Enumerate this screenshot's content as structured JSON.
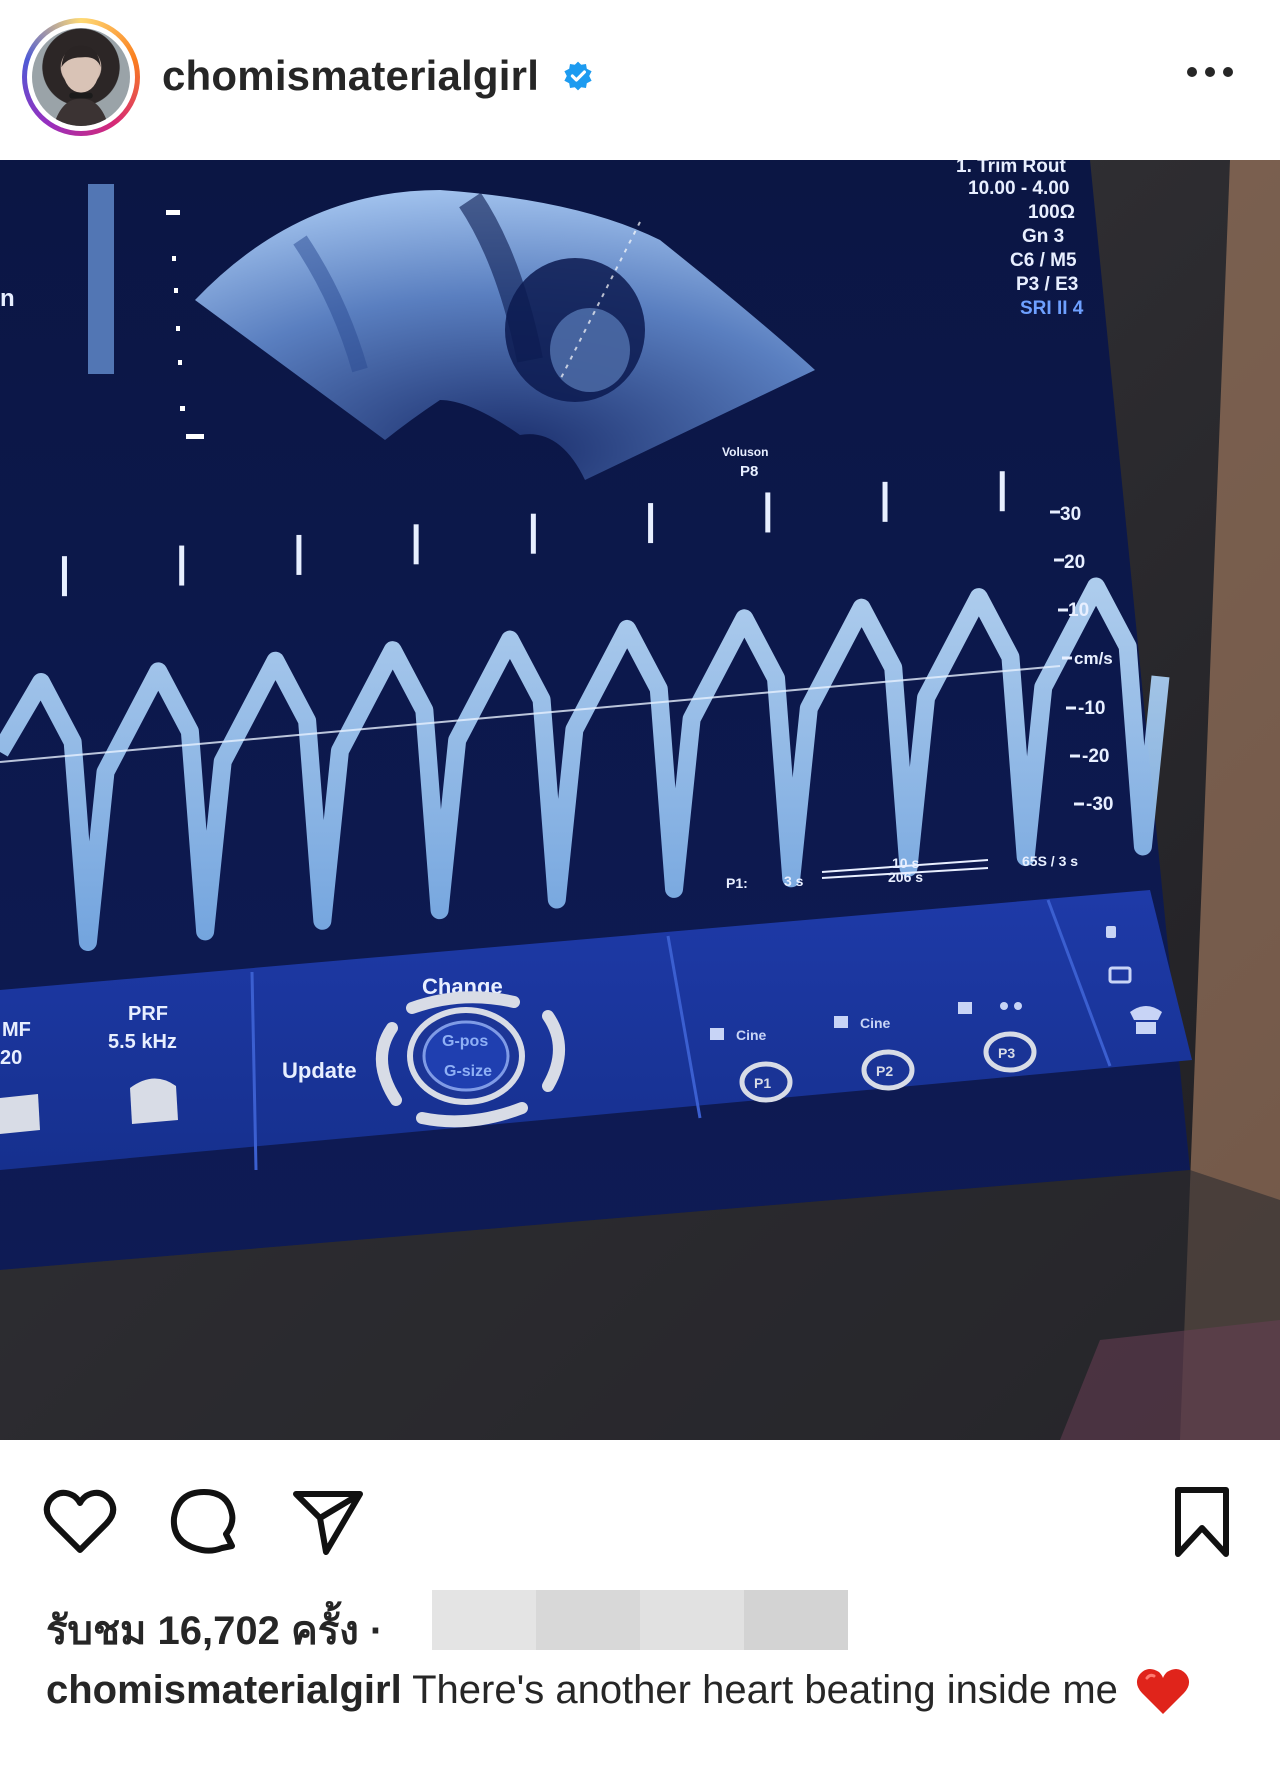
{
  "post": {
    "username": "chomismaterialgirl",
    "verified": true,
    "more_icon": "more-horizontal-icon",
    "avatar": "profile-avatar"
  },
  "monitor": {
    "params": [
      "10.00 - 4.00",
      "100Ω",
      "Gn 3",
      "C6 / M5",
      "P3 / E3",
      "SRI II 4"
    ],
    "params_header": "1. Trim Rout",
    "brand": "Voluson",
    "model": "P8",
    "velocity_scale": [
      "30",
      "20",
      "10",
      "cm/s",
      "-10",
      "-20",
      "-30"
    ],
    "bottom_labels": [
      "P1:",
      "3 s",
      "10 s",
      "206 s",
      "65S / 3 s"
    ],
    "controls": {
      "mf_label": "MF",
      "mf_value": "20",
      "prf_label": "PRF",
      "prf_value": "5.5 kHz",
      "update_label": "Update",
      "change_label": "Change",
      "gpos_label": "G-pos",
      "gsize_label": "G-size",
      "cine_label": "Cine",
      "p1": "P1",
      "p2": "P2",
      "p3": "P3",
      "left_edge": "n"
    }
  },
  "actions": {
    "like_icon": "heart-outline-icon",
    "comment_icon": "comment-icon",
    "share_icon": "paper-plane-icon",
    "save_icon": "bookmark-icon"
  },
  "stats": {
    "views_text": "รับชม 16,702 ครั้ง ·"
  },
  "caption": {
    "username": "chomismaterialgirl",
    "text": " There's another heart beating inside me",
    "emoji": "red-heart-emoji"
  }
}
